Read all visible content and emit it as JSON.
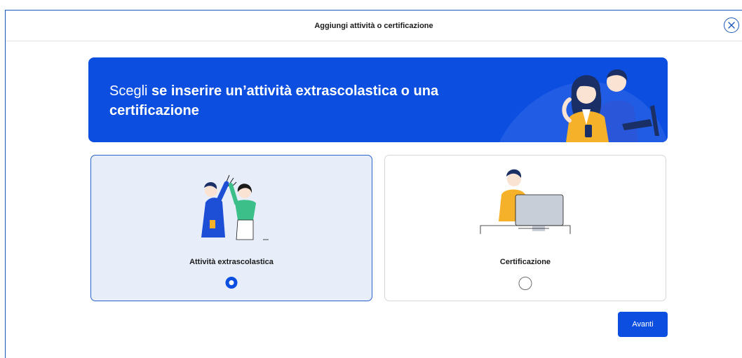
{
  "modal": {
    "title": "Aggiungi attività o certificazione",
    "close_icon": "close-circle-icon",
    "accent_color": "#1a56b8"
  },
  "banner": {
    "text_regular": "Scegli ",
    "text_bold": "se inserire un’attività extrascolastica o una certificazione",
    "background_color": "#0c4fe0"
  },
  "options": [
    {
      "label": "Attività extrascolastica",
      "selected": true
    },
    {
      "label": "Certificazione",
      "selected": false
    }
  ],
  "footer": {
    "next_label": "Avanti"
  }
}
